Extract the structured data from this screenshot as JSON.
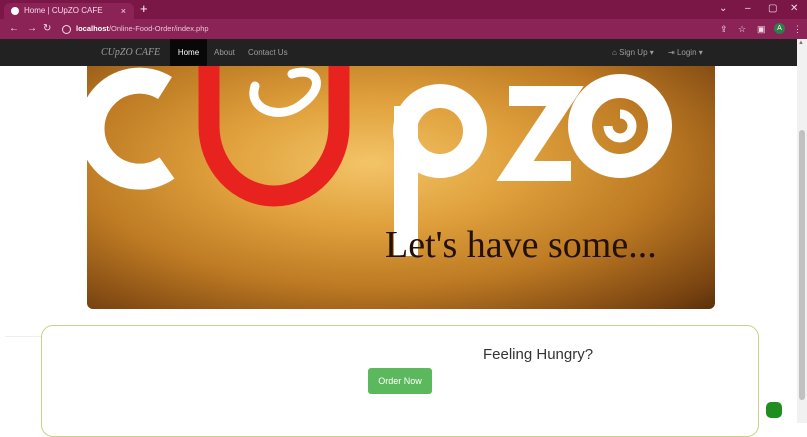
{
  "browser": {
    "tab_title": "Home | CUpZO CAFE",
    "tab_close": "×",
    "new_tab": "+",
    "win_minimize": "⌄",
    "win_min": "–",
    "win_max": "▢",
    "win_close": "✕",
    "back": "←",
    "forward": "→",
    "reload": "↻",
    "url_host": "localhost",
    "url_path": "/Online-Food-Order/index.php",
    "share_icon": "⇪",
    "star_icon": "☆",
    "ext_icon": "▣",
    "profile_initial": "A",
    "menu_icon": "⋮",
    "theme_color": "#7a1746"
  },
  "nav": {
    "brand": "CUpZO CAFE",
    "home": "Home",
    "about": "About",
    "contact": "Contact Us",
    "signup": "Sign Up",
    "login": "Login"
  },
  "hero": {
    "logo_letters": "cUpzo",
    "tagline": "Let's have some..."
  },
  "promo": {
    "title": "Feeling Hungry?",
    "button": "Order Now",
    "button_color": "#5cb85c"
  }
}
